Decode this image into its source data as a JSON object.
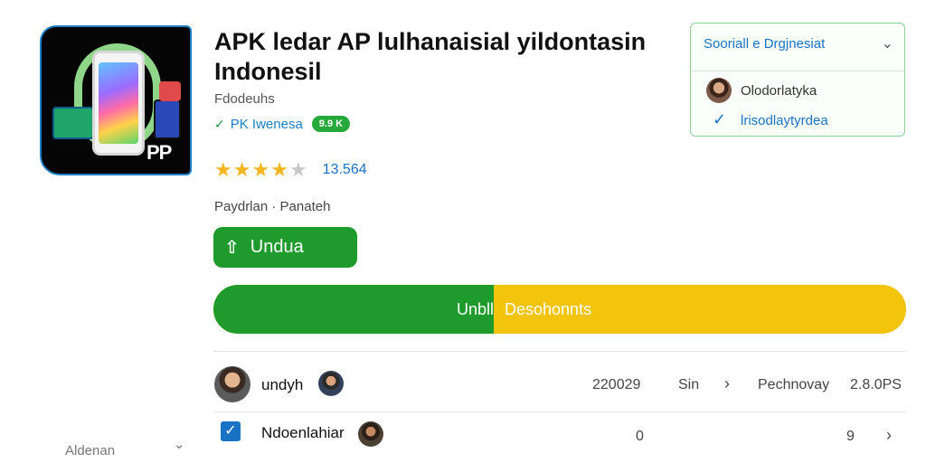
{
  "app": {
    "title": "APK ledar AP lulhanaisial yildontasin Indonesil",
    "developer": "Fdodeuhs",
    "verified_text": "PK Iwenesa",
    "verified_badge": "9.9 K",
    "rating_stars": 4,
    "rating_max": 5,
    "rating_count": "13.564",
    "meta": "Paydrlan · Panateh",
    "icon_badge": "PP"
  },
  "download": {
    "label": "Undua",
    "icon": "download-share-icon"
  },
  "progress": {
    "fraction": 0.405,
    "left_label": "Unbll",
    "right_label": "Desohonnts",
    "fill_color": "#1f9a2c",
    "track_color": "#f2c40c"
  },
  "rows": [
    {
      "name": "undyh",
      "value": "220029",
      "size": "Sin",
      "status": "Pechnovay",
      "version": "2.8.0PS",
      "arrow": "›"
    },
    {
      "name": "Ndoenlahiar",
      "value": "0",
      "value2": "9",
      "arrow": "›"
    }
  ],
  "language_card": {
    "header": "Sooriall e Drgjnesiat",
    "user": "Olodorlatyka",
    "verified": "lrisodlaytyrdea"
  },
  "sidebar": {
    "select_label": "Aldenan"
  },
  "colors": {
    "accent_green": "#1f9a2c",
    "accent_blue": "#1a72c4",
    "star": "#f3b61f",
    "progress_yellow": "#f2c40c"
  }
}
